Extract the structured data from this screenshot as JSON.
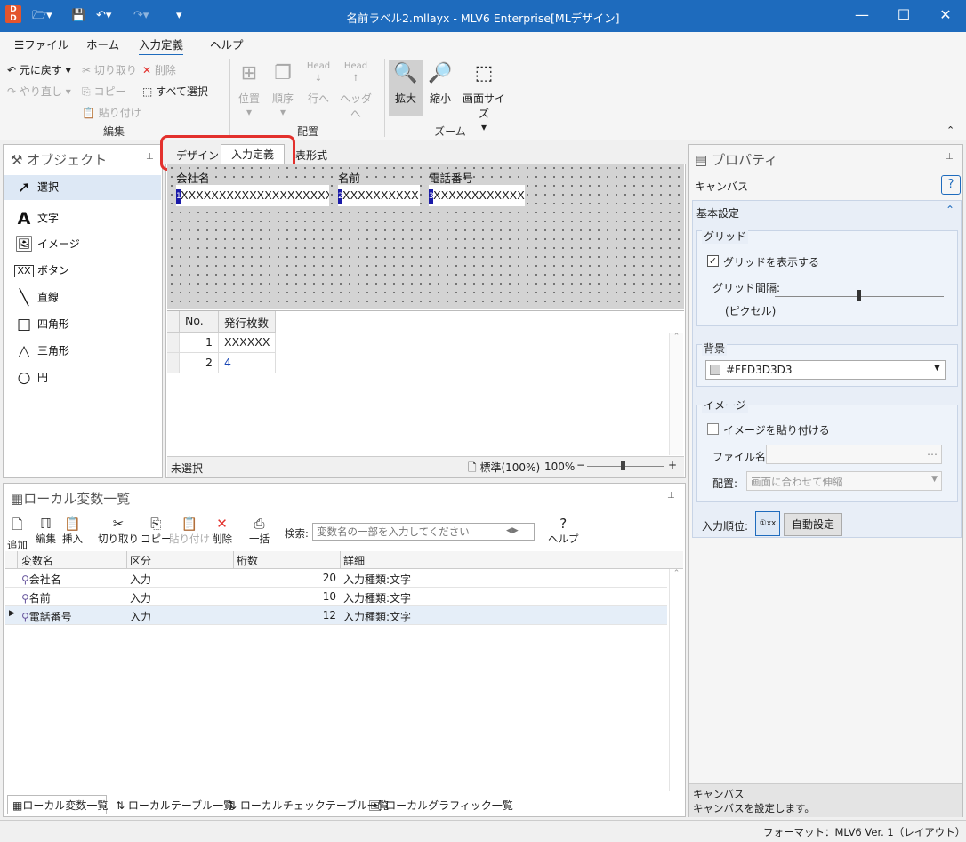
{
  "window": {
    "title": "名前ラベル2.mllayx - MLV6 Enterprise[MLデザイン]",
    "minimize": "—",
    "maximize": "☐",
    "close": "✕"
  },
  "menu": {
    "file": "ファイル",
    "home": "ホーム",
    "input_def": "入力定義",
    "help": "ヘルプ"
  },
  "ribbon": {
    "undo": "元に戻す",
    "redo": "やり直し",
    "cut": "切り取り",
    "copy": "コピー",
    "paste": "貼り付け",
    "delete": "削除",
    "select_all": "すべて選択",
    "position": "位置",
    "order": "順序",
    "to_row": "行へ",
    "to_header": "ヘッダへ",
    "head1": "Head",
    "head2": "Head",
    "zoom_in": "拡大",
    "zoom_out": "縮小",
    "screen_size": "画面サイズ",
    "group_edit": "編集",
    "group_layout": "配置",
    "group_zoom": "ズーム"
  },
  "objects_panel": {
    "title": "オブジェクト",
    "items": [
      "選択",
      "文字",
      "イメージ",
      "ボタン",
      "直線",
      "四角形",
      "三角形",
      "円"
    ]
  },
  "editor_tabs": {
    "design": "デザイン",
    "input_def": "入力定義",
    "table": "表形式"
  },
  "canvas": {
    "fields": [
      {
        "label": "会社名",
        "num": "1",
        "value": "XXXXXXXXXXXXXXXXXXXX"
      },
      {
        "label": "名前",
        "num": "2",
        "value": "XXXXXXXXXX"
      },
      {
        "label": "電話番号",
        "num": "3",
        "value": "XXXXXXXXXXXX"
      }
    ],
    "background": "#d3d3d3"
  },
  "data_grid": {
    "headers": [
      "No.",
      "発行枚数"
    ],
    "rows": [
      [
        "1",
        "XXXXXX"
      ],
      [
        "2",
        "4"
      ]
    ]
  },
  "editor_status": {
    "selection": "未選択",
    "zoom_mode": "標準(100%)",
    "zoom": "100%"
  },
  "variables_panel": {
    "title": "ローカル変数一覧",
    "toolbar": {
      "add": "追加",
      "edit": "編集",
      "insert": "挿入",
      "cut": "切り取り",
      "copy": "コピー",
      "paste": "貼り付け",
      "delete": "削除",
      "batch": "一括",
      "search_label": "検索:",
      "search_placeholder": "変数名の一部を入力してください",
      "help": "ヘルプ"
    },
    "columns": [
      "変数名",
      "区分",
      "桁数",
      "詳細"
    ],
    "rows": [
      [
        "会社名",
        "入力",
        "20",
        "入力種類:文字"
      ],
      [
        "名前",
        "入力",
        "10",
        "入力種類:文字"
      ],
      [
        "電話番号",
        "入力",
        "12",
        "入力種類:文字"
      ]
    ]
  },
  "bottom_tabs": [
    "ローカル変数一覧",
    "ローカルテーブル一覧",
    "ローカルチェックテーブル一覧",
    "ローカルグラフィック一覧"
  ],
  "properties": {
    "title": "プロパティ",
    "target": "キャンバス",
    "section": "基本設定",
    "grid_group": "グリッド",
    "show_grid": "グリッドを表示する",
    "grid_spacing": "グリッド間隔:",
    "pixels": "(ピクセル)",
    "background_group": "背景",
    "background_value": "#FFD3D3D3",
    "image_group": "イメージ",
    "paste_image": "イメージを貼り付ける",
    "file_name": "ファイル名:",
    "placement": "配置:",
    "placement_value": "画面に合わせて伸縮",
    "input_order": "入力順位:",
    "auto_set": "自動設定",
    "footer_title": "キャンバス",
    "footer_desc": "キャンバスを設定します。"
  },
  "statusbar": {
    "format": "フォーマット：MLV6 Ver. 1（レイアウト）"
  },
  "colors": {
    "accent": "#1e6bbd",
    "highlight": "#e3312d"
  }
}
